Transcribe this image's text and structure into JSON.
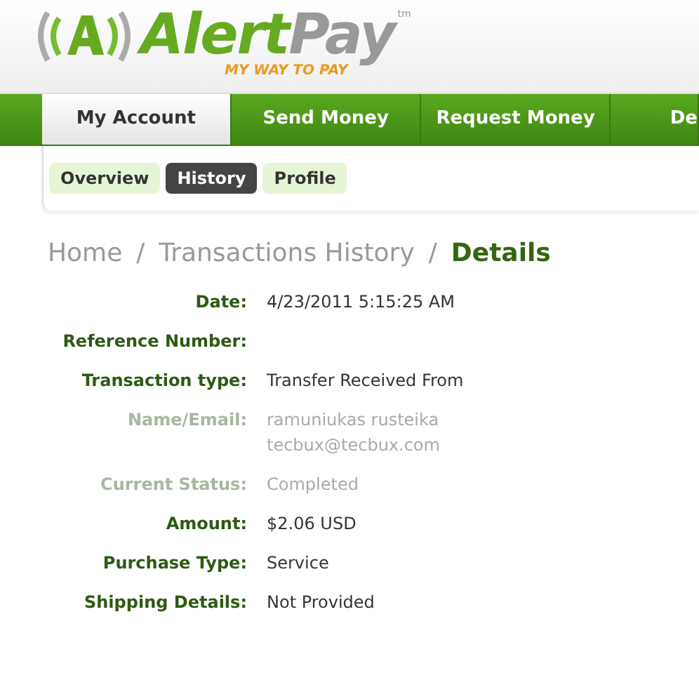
{
  "logo": {
    "word_1": "Alert",
    "word_2": "Pay",
    "trademark": "tm",
    "tagline": "MY WAY TO PAY"
  },
  "tabs": [
    {
      "label": "My Account",
      "selected": true
    },
    {
      "label": "Send Money",
      "selected": false
    },
    {
      "label": "Request Money",
      "selected": false
    },
    {
      "label": "De",
      "selected": false
    }
  ],
  "subtabs": [
    {
      "label": "Overview",
      "selected": false
    },
    {
      "label": "History",
      "selected": true
    },
    {
      "label": "Profile",
      "selected": false
    }
  ],
  "breadcrumb": [
    {
      "label": "Home",
      "current": false
    },
    {
      "separator": "/",
      "label": "Transactions History",
      "current": false
    },
    {
      "separator": "/",
      "label": "Details",
      "current": true
    }
  ],
  "details": [
    {
      "label": "Date:",
      "values": [
        "4/23/2011 5:15:25 AM"
      ],
      "faded": false
    },
    {
      "label": "Reference Number:",
      "faded": false
    },
    {
      "label": "Transaction type:",
      "values": [
        "Transfer Received From"
      ],
      "faded": false
    },
    {
      "label": "Name/Email:",
      "values": [
        "ramuniukas rusteika",
        "tecbux@tecbux.com"
      ],
      "faded": true
    },
    {
      "label": "Current Status:",
      "values": [
        "Completed"
      ],
      "faded": true
    },
    {
      "label": "Amount:",
      "values": [
        "$2.06 USD"
      ],
      "faded": false
    },
    {
      "label": "Purchase Type:",
      "values": [
        "Service"
      ],
      "faded": false
    },
    {
      "label": "Shipping Details:",
      "values": [
        "Not Provided"
      ],
      "faded": false
    }
  ]
}
